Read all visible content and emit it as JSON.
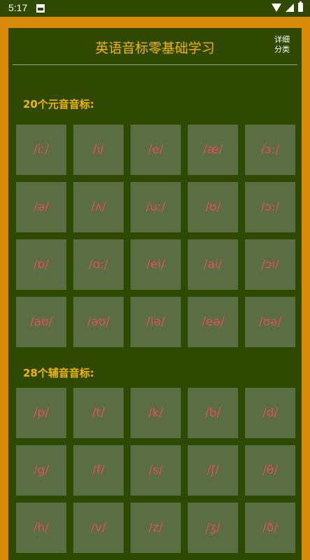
{
  "status_bar": {
    "time": "5:17"
  },
  "header": {
    "title": "英语音标零基础学习",
    "detail_line1": "详细",
    "detail_line2": "分类"
  },
  "vowels": {
    "title": "20个元音音标:",
    "items": [
      "/iː/",
      "/i/",
      "/e/",
      "/æ/",
      "/ɜː/",
      "/ə/",
      "/ʌ/",
      "/uː/",
      "/ʊ/",
      "/ɔː/",
      "/ɒ/",
      "/ɑː/",
      "/ei/",
      "/ai/",
      "/ɔi/",
      "/aʊ/",
      "/əʊ/",
      "/iə/",
      "/eə/",
      "/ʊə/"
    ]
  },
  "consonants": {
    "title": "28个辅音音标:",
    "items": [
      "/p/",
      "/t/",
      "/k/",
      "/b/",
      "/d/",
      "/g/",
      "/f/",
      "/s/",
      "/ʃ/",
      "/θ/",
      "/h/",
      "/v/",
      "/z/",
      "/ʒ/",
      "/ð/"
    ]
  },
  "colors": {
    "background": "#2f4a00",
    "frame": "#d88a08",
    "accent": "#f4b400",
    "cell": "#5b6e43",
    "phonetic_text": "#e0505a"
  },
  "icons": {
    "notification": "notification-icon",
    "wifi": "wifi-icon",
    "signal": "signal-icon",
    "battery": "battery-icon"
  }
}
